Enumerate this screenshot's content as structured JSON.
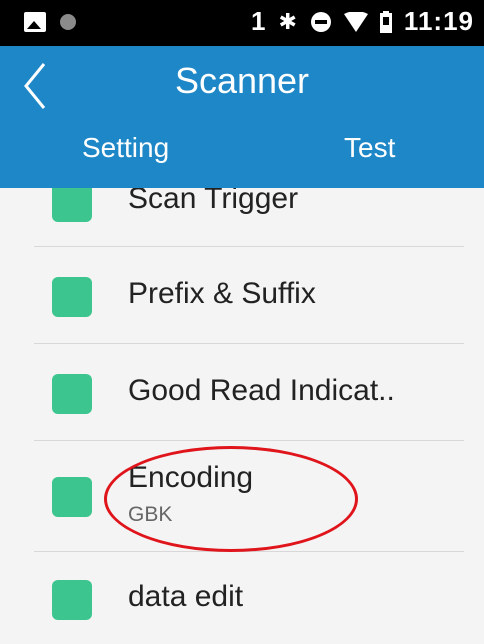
{
  "status_bar": {
    "left_icons": [
      "image-icon",
      "dot-icon"
    ],
    "sim_slot": "1",
    "right_icons": [
      "bluetooth-icon",
      "dnd-icon",
      "wifi-icon",
      "battery-icon"
    ],
    "time": "11:19"
  },
  "header": {
    "title": "Scanner",
    "back_icon": "chevron-left-icon"
  },
  "tabs": [
    {
      "label": "Setting"
    },
    {
      "label": "Test"
    }
  ],
  "list": {
    "items": [
      {
        "label": "Scan Trigger",
        "icon": "scan-trigger-icon"
      },
      {
        "label": "Prefix & Suffix",
        "icon": "prefix-suffix-icon"
      },
      {
        "label": "Good Read Indicat..",
        "icon": "good-read-icon"
      },
      {
        "label": "Encoding",
        "sublabel": "GBK",
        "icon": "barcode-icon"
      },
      {
        "label": "data edit",
        "icon": "data-edit-icon"
      }
    ]
  },
  "colors": {
    "header_bg": "#1e87c8",
    "icon_green": "#3cc58e",
    "annotation": "#e0141b"
  }
}
